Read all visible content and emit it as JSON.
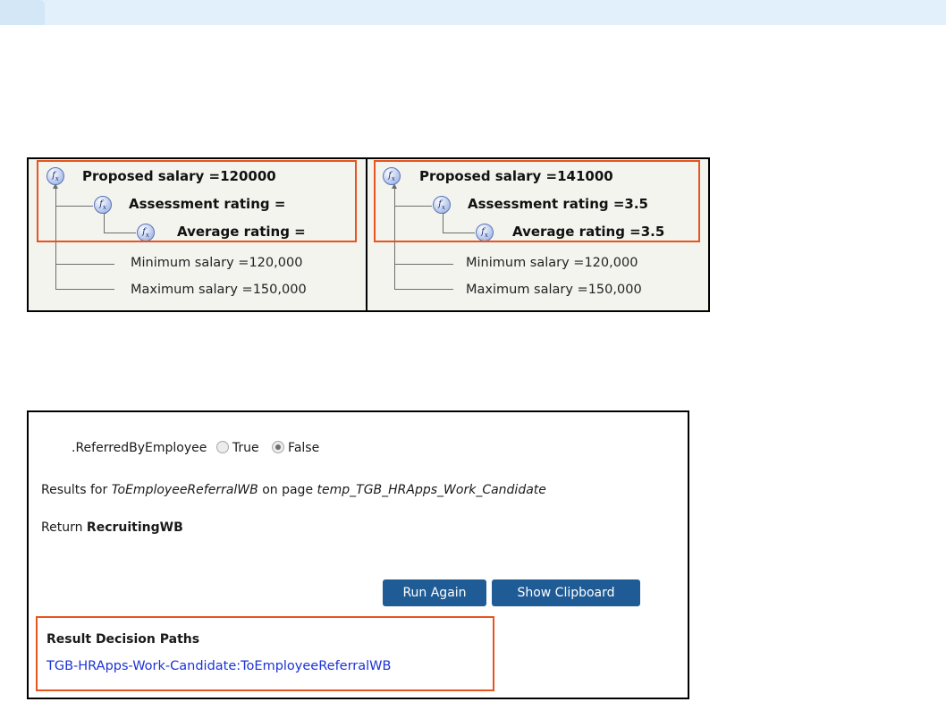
{
  "decision_tree": {
    "before": {
      "proposed": "Proposed salary =120000",
      "assessment": "Assessment rating =",
      "average": "Average rating =",
      "min": "Minimum salary =120,000",
      "max": "Maximum salary =150,000"
    },
    "after": {
      "proposed": "Proposed salary =141000",
      "assessment": "Assessment rating =3.5",
      "average": "Average rating =3.5",
      "min": "Minimum salary =120,000",
      "max": "Maximum salary =150,000"
    },
    "function_icon_glyph": "fx",
    "highlight_color": "#e8541e"
  },
  "test_result": {
    "field_label": ".ReferredByEmployee",
    "radio_true": "True",
    "radio_false": "False",
    "selected": "False",
    "results_prefix": "Results for ",
    "rule_name": "ToEmployeeReferralWB",
    "page_prefix": " on page ",
    "page_name": "temp_TGB_HRApps_Work_Candidate",
    "return_prefix": "Return ",
    "return_value": "RecruitingWB",
    "run_again_label": "Run Again",
    "show_clipboard_label": "Show Clipboard",
    "button_color": "#1f5b95",
    "paths_title": "Result Decision Paths",
    "paths_link": "TGB-HRApps-Work-Candidate:ToEmployeeReferralWB",
    "link_color": "#1c33d6"
  }
}
